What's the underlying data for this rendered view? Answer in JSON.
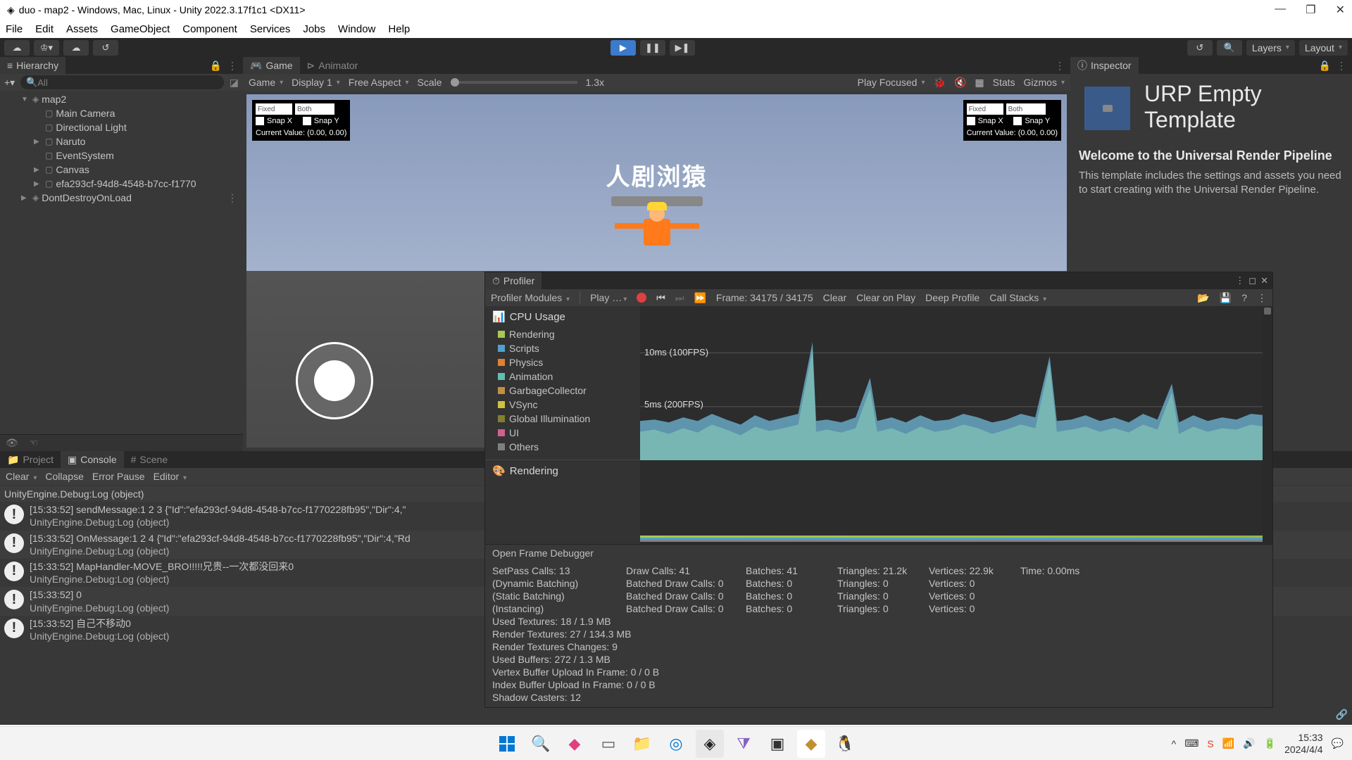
{
  "titlebar": {
    "title": "duo - map2 - Windows, Mac, Linux - Unity 2022.3.17f1c1 <DX11>"
  },
  "menu": [
    "File",
    "Edit",
    "Assets",
    "GameObject",
    "Component",
    "Services",
    "Jobs",
    "Window",
    "Help"
  ],
  "toolbar": {
    "layers": "Layers",
    "layout": "Layout"
  },
  "hierarchy": {
    "tab": "Hierarchy",
    "search_placeholder": "All",
    "root": "map2",
    "items": [
      "Main Camera",
      "Directional Light",
      "Naruto",
      "EventSystem",
      "Canvas",
      "efa293cf-94d8-4548-b7cc-f1770"
    ],
    "extra": "DontDestroyOnLoad"
  },
  "game_view": {
    "tab_game": "Game",
    "tab_animator": "Animator",
    "dropdown_game": "Game",
    "display": "Display 1",
    "aspect": "Free Aspect",
    "scale_label": "Scale",
    "scale_value": "1.3x",
    "play_focused": "Play Focused",
    "stats": "Stats",
    "gizmos": "Gizmos",
    "overlay": {
      "fixed": "Fixed",
      "both": "Both",
      "snapx": "Snap X",
      "snapy": "Snap Y",
      "current": "Current Value: (0.00, 0.00)"
    },
    "title_text": "人剧浏猿"
  },
  "inspector": {
    "tab": "Inspector",
    "title": "URP Empty Template",
    "welcome_heading": "Welcome to the Universal Render Pipeline",
    "welcome_body": "This template includes the settings and assets you need to start creating with the Universal Render Pipeline."
  },
  "profiler": {
    "tab": "Profiler",
    "modules_label": "Profiler Modules",
    "play_label": "Play …",
    "frame_label": "Frame: 34175 / 34175",
    "clear": "Clear",
    "clear_on_play": "Clear on Play",
    "deep_profile": "Deep Profile",
    "call_stacks": "Call Stacks",
    "cpu_header": "CPU Usage",
    "modules": [
      {
        "name": "Rendering",
        "color": "#a8c850"
      },
      {
        "name": "Scripts",
        "color": "#50a0d0"
      },
      {
        "name": "Physics",
        "color": "#e08030"
      },
      {
        "name": "Animation",
        "color": "#60c0b0"
      },
      {
        "name": "GarbageCollector",
        "color": "#c09040"
      },
      {
        "name": "VSync",
        "color": "#d0c040"
      },
      {
        "name": "Global Illumination",
        "color": "#808030"
      },
      {
        "name": "UI",
        "color": "#d06090"
      },
      {
        "name": "Others",
        "color": "#808080"
      }
    ],
    "line10": "10ms (100FPS)",
    "line5": "5ms (200FPS)",
    "rendering_header": "Rendering",
    "open_frame_debugger": "Open Frame Debugger",
    "stats": {
      "setpass": "SetPass Calls: 13",
      "drawcalls": "Draw Calls: 41",
      "batches": "Batches: 41",
      "triangles": "Triangles: 21.2k",
      "vertices": "Vertices: 22.9k",
      "time": "Time: 0.00ms",
      "dyn_batch": "(Dynamic Batching)",
      "batched_dc0": "Batched Draw Calls: 0",
      "batches0": "Batches: 0",
      "tri0": "Triangles: 0",
      "vert0": "Vertices: 0",
      "static_batch": "(Static Batching)",
      "instancing": "(Instancing)",
      "used_tex": "Used Textures: 18 / 1.9 MB",
      "render_tex": "Render Textures: 27 / 134.3 MB",
      "render_tex_chg": "Render Textures Changes: 9",
      "used_buf": "Used Buffers: 272 / 1.3 MB",
      "vb_upload": "Vertex Buffer Upload In Frame: 0 / 0 B",
      "ib_upload": "Index Buffer Upload In Frame: 0 / 0 B",
      "shadow": "Shadow Casters: 12"
    }
  },
  "bottom": {
    "tab_project": "Project",
    "tab_console": "Console",
    "tab_scene": "Scene",
    "clear": "Clear",
    "collapse": "Collapse",
    "error_pause": "Error Pause",
    "editor": "Editor",
    "logs": [
      {
        "l1": "UnityEngine.Debug:Log (object)",
        "l2": ""
      },
      {
        "l1": "[15:33:52] sendMessage:1 2 3 {\"Id\":\"efa293cf-94d8-4548-b7cc-f1770228fb95\",\"Dir\":4,\"",
        "l2": "UnityEngine.Debug:Log (object)"
      },
      {
        "l1": "[15:33:52] OnMessage:1 2 4 {\"Id\":\"efa293cf-94d8-4548-b7cc-f1770228fb95\",\"Dir\":4,\"Rd",
        "l2": "UnityEngine.Debug:Log (object)"
      },
      {
        "l1": "[15:33:52] MapHandler-MOVE_BRO!!!!!兄贵--一次都没回来0",
        "l2": "UnityEngine.Debug:Log (object)"
      },
      {
        "l1": "[15:33:52] 0",
        "l2": "UnityEngine.Debug:Log (object)"
      },
      {
        "l1": "[15:33:52] 自己不移动0",
        "l2": "UnityEngine.Debug:Log (object)"
      }
    ]
  },
  "taskbar": {
    "time": "15:33",
    "date": "2024/4/4"
  },
  "chart_data": {
    "type": "area",
    "title": "CPU Usage",
    "xlabel": "Frame",
    "ylabel": "ms",
    "ylim": [
      0,
      12
    ],
    "gridlines_ms": [
      5,
      10
    ],
    "series": [
      {
        "name": "Rendering",
        "color": "#a8c850"
      },
      {
        "name": "Scripts",
        "color": "#50a0d0"
      },
      {
        "name": "VSync",
        "color": "#d0c040"
      }
    ],
    "approx_baseline_ms": 3.5,
    "approx_peaks_ms": [
      9,
      10,
      6,
      8,
      7
    ],
    "note": "stacked area fluctuating around 3-5ms with occasional spikes to ~10ms"
  }
}
